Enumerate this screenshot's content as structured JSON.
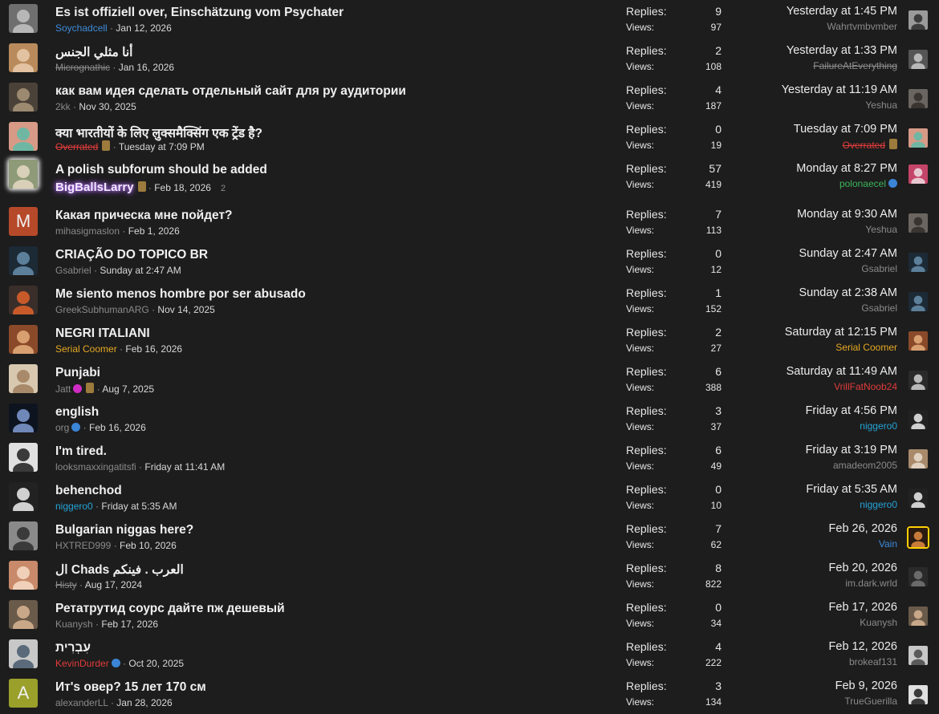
{
  "labels": {
    "replies": "Replies:",
    "views": "Views:"
  },
  "threads": [
    {
      "title": "Es ist offiziell over, Einschätzung vom Psychater",
      "author": "Soychadcell",
      "author_style": "blue",
      "date": "Jan 12, 2026",
      "replies": "9",
      "views": "97",
      "last_date": "Yesterday at 1:45 PM",
      "last_user": "Wahrtvmbvmber",
      "last_user_style": "",
      "avatar_colors": [
        "#6f6f6f",
        "#b7b7b7"
      ],
      "mini_colors": [
        "#9a9a9a",
        "#3c3c3c"
      ]
    },
    {
      "title": "أنا مثلي الجنس",
      "author": "Micrognathic",
      "author_style": "strike",
      "date": "Jan 16, 2026",
      "replies": "2",
      "views": "108",
      "last_date": "Yesterday at 1:33 PM",
      "last_user": "FailureAtEverything",
      "last_user_style": "strike",
      "avatar_colors": [
        "#b98b5c",
        "#e2c2a0"
      ],
      "mini_colors": [
        "#555555",
        "#b8b8b8"
      ]
    },
    {
      "title": "как вам идея сделать отдельный сайт для ру аудитории",
      "author": "2kk",
      "author_style": "",
      "date": "Nov 30, 2025",
      "replies": "4",
      "views": "187",
      "last_date": "Yesterday at 11:19 AM",
      "last_user": "Yeshua",
      "last_user_style": "",
      "avatar_colors": [
        "#4a4238",
        "#9c8a70"
      ],
      "mini_colors": [
        "#6a6560",
        "#3a3530"
      ]
    },
    {
      "title": "क्या भारतीयों के लिए लुक्समैक्सिंग एक ट्रेंड है?",
      "author": "Overrated",
      "author_style": "red strike",
      "coin": true,
      "date": "Tuesday at 7:09 PM",
      "replies": "0",
      "views": "19",
      "last_date": "Tuesday at 7:09 PM",
      "last_user": "Overrated",
      "last_user_style": "red strike",
      "last_coin": true,
      "avatar_colors": [
        "#d79a86",
        "#6fb7a3"
      ],
      "mini_colors": [
        "#d79a86",
        "#6fb7a3"
      ]
    },
    {
      "title": "A polish subforum should be added",
      "author": "BigBallsLarry",
      "author_style": "big",
      "coin": true,
      "date": "Feb 18, 2026",
      "pages": "2",
      "replies": "57",
      "views": "419",
      "last_date": "Monday at 8:27 PM",
      "last_user": "polonaecel",
      "last_user_style": "green",
      "last_verified": true,
      "avatar_colors": [
        "#8e9a78",
        "#d8d0b8"
      ],
      "mini_colors": [
        "#c5446a",
        "#e8c8d0"
      ]
    },
    {
      "title": "Какая прическа мне пойдет?",
      "author": "mihasigmaslon",
      "author_style": "",
      "date": "Feb 1, 2026",
      "replies": "7",
      "views": "113",
      "last_date": "Monday at 9:30 AM",
      "last_user": "Yeshua",
      "last_user_style": "",
      "avatar_letter": "M",
      "avatar_letter_bg": "#b6492a",
      "mini_colors": [
        "#6a6560",
        "#3a3530"
      ]
    },
    {
      "title": "CRIAÇÃO DO TOPICO BR",
      "author": "Gsabriel",
      "author_style": "",
      "date": "Sunday at 2:47 AM",
      "replies": "0",
      "views": "12",
      "last_date": "Sunday at 2:47 AM",
      "last_user": "Gsabriel",
      "last_user_style": "",
      "avatar_colors": [
        "#1c2a36",
        "#5c7f9a"
      ],
      "mini_colors": [
        "#1c2a36",
        "#5c7f9a"
      ]
    },
    {
      "title": "Me siento menos hombre por ser abusado",
      "author": "GreekSubhumanARG",
      "author_style": "",
      "date": "Nov 14, 2025",
      "replies": "1",
      "views": "152",
      "last_date": "Sunday at 2:38 AM",
      "last_user": "Gsabriel",
      "last_user_style": "",
      "avatar_colors": [
        "#3a2e2a",
        "#c85a2a"
      ],
      "mini_colors": [
        "#1c2a36",
        "#5c7f9a"
      ]
    },
    {
      "title": "NEGRI ITALIANI",
      "author": "Serial Coomer",
      "author_style": "orange",
      "date": "Feb 16, 2026",
      "replies": "2",
      "views": "27",
      "last_date": "Saturday at 12:15 PM",
      "last_user": "Serial Coomer",
      "last_user_style": "orange",
      "avatar_colors": [
        "#8a4a2a",
        "#d8a070"
      ],
      "mini_colors": [
        "#8a4a2a",
        "#d8a070"
      ]
    },
    {
      "title": "Punjabi",
      "author": "Jatt",
      "author_style": "",
      "member_badge": true,
      "coin": true,
      "date": "Aug 7, 2025",
      "replies": "6",
      "views": "388",
      "last_date": "Saturday at 11:49 AM",
      "last_user": "VrillFatNoob24",
      "last_user_style": "red",
      "avatar_colors": [
        "#d8c8b0",
        "#a88a6a"
      ],
      "mini_colors": [
        "#2a2a2a",
        "#b8b8b8"
      ]
    },
    {
      "title": "english",
      "author": "org",
      "author_style": "",
      "verified": true,
      "date": "Feb 16, 2026",
      "replies": "3",
      "views": "37",
      "last_date": "Friday at 4:56 PM",
      "last_user": "niggero0",
      "last_user_style": "cyan",
      "avatar_colors": [
        "#0d1420",
        "#6f88b8"
      ],
      "mini_colors": [
        "#222222",
        "#d0d0d0"
      ]
    },
    {
      "title": "I'm tired.",
      "author": "looksmaxxingatitsfi",
      "author_style": "",
      "date": "Friday at 11:41 AM",
      "replies": "6",
      "views": "49",
      "last_date": "Friday at 3:19 PM",
      "last_user": "amadeom2005",
      "last_user_style": "",
      "avatar_colors": [
        "#e0e0e0",
        "#3a3a3a"
      ],
      "mini_colors": [
        "#a88a6a",
        "#e0d0c0"
      ]
    },
    {
      "title": "behenchod",
      "author": "niggero0",
      "author_style": "cyan",
      "date": "Friday at 5:35 AM",
      "replies": "0",
      "views": "10",
      "last_date": "Friday at 5:35 AM",
      "last_user": "niggero0",
      "last_user_style": "cyan",
      "avatar_colors": [
        "#222222",
        "#d0d0d0"
      ],
      "mini_colors": [
        "#222222",
        "#d0d0d0"
      ]
    },
    {
      "title": "Bulgarian niggas here?",
      "author": "HXTRED999",
      "author_style": "",
      "date": "Feb 10, 2026",
      "replies": "7",
      "views": "62",
      "last_date": "Feb 26, 2026",
      "last_user": "Vain",
      "last_user_style": "blue",
      "last_gold": true,
      "avatar_colors": [
        "#8a8a8a",
        "#3a3a3a"
      ],
      "mini_colors": [
        "#2a1a10",
        "#c87a3a"
      ]
    },
    {
      "title": "ال Chads العرب . فينكم",
      "author": "Histy",
      "author_style": "strike",
      "date": "Aug 17, 2024",
      "replies": "8",
      "views": "822",
      "last_date": "Feb 20, 2026",
      "last_user": "im.dark.wrld",
      "last_user_style": "",
      "avatar_colors": [
        "#c88a6a",
        "#f0d0b8"
      ],
      "mini_colors": [
        "#2a2a2a",
        "#6a6a6a"
      ]
    },
    {
      "title": "Ретатрутид соурс дайте пж дешевый",
      "author": "Kuanysh",
      "author_style": "",
      "date": "Feb 17, 2026",
      "replies": "0",
      "views": "34",
      "last_date": "Feb 17, 2026",
      "last_user": "Kuanysh",
      "last_user_style": "",
      "avatar_colors": [
        "#6a5a4a",
        "#c8a888"
      ],
      "mini_colors": [
        "#6a5a4a",
        "#c8a888"
      ]
    },
    {
      "title": "עִבְרִית",
      "author": "KevinDurder",
      "author_style": "red",
      "verified": true,
      "date": "Oct 20, 2025",
      "replies": "4",
      "views": "222",
      "last_date": "Feb 12, 2026",
      "last_user": "brokeaf131",
      "last_user_style": "",
      "avatar_colors": [
        "#c8c8c8",
        "#5a6a7a"
      ],
      "mini_colors": [
        "#c8c8c8",
        "#5a5a5a"
      ]
    },
    {
      "title": "Ит's овер? 15 лет 170 см",
      "author": "alexanderLL",
      "author_style": "",
      "date": "Jan 28, 2026",
      "replies": "3",
      "views": "134",
      "last_date": "Feb 9, 2026",
      "last_user": "TrueGuerilla",
      "last_user_style": "",
      "avatar_letter": "A",
      "avatar_letter_bg": "#9aa02a",
      "mini_colors": [
        "#e0e0e0",
        "#3a3a3a"
      ]
    }
  ]
}
